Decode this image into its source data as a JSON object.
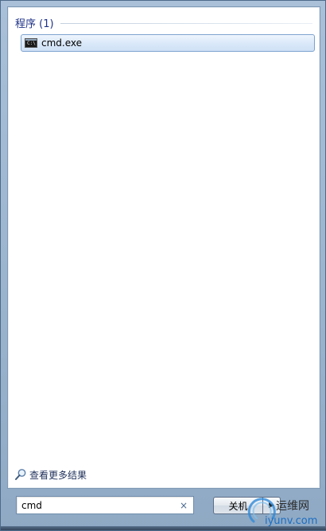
{
  "results": {
    "group_title": "程序 (1)",
    "items": [
      {
        "label": "cmd.exe",
        "icon": "cmd-icon"
      }
    ]
  },
  "more_results": {
    "label": "查看更多结果",
    "icon": "magnifier-icon"
  },
  "search": {
    "value": "cmd",
    "clear_glyph": "×"
  },
  "shutdown": {
    "label": "关机",
    "arrow_glyph": "▶"
  },
  "watermark": {
    "name": "运维网",
    "url": "iyunv.com"
  },
  "colors": {
    "group_title": "#1e3287",
    "selection_border": "#7da2ce",
    "link_blue": "#1c6ec2"
  }
}
